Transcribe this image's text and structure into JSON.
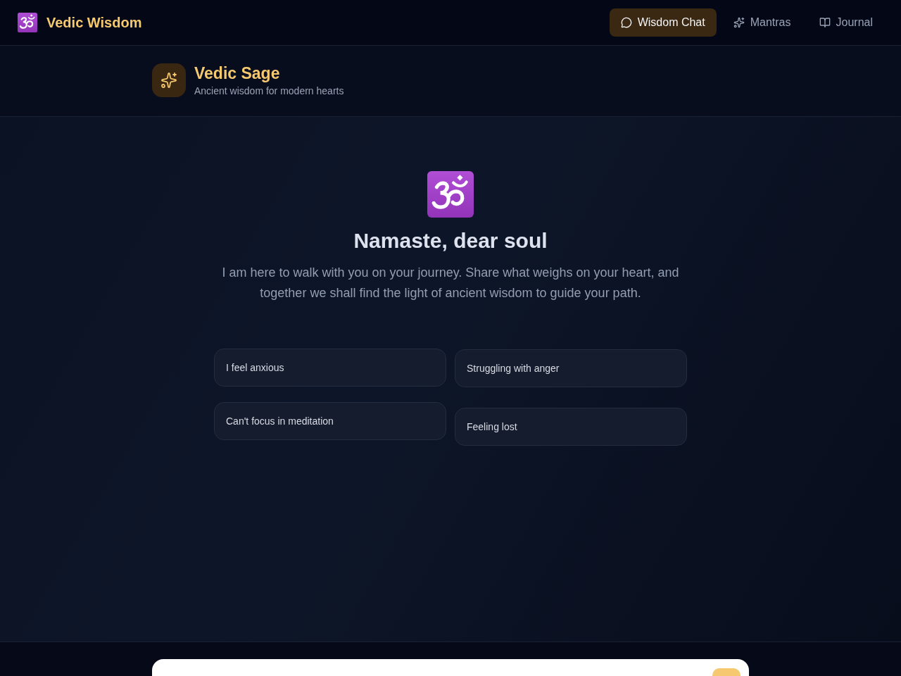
{
  "nav": {
    "brand": "Vedic Wisdom",
    "tabs": [
      {
        "label": "Wisdom Chat",
        "selected": true
      },
      {
        "label": "Mantras",
        "selected": false
      },
      {
        "label": "Journal",
        "selected": false
      }
    ]
  },
  "header": {
    "title": "Vedic Sage",
    "subtitle": "Ancient wisdom for modern hearts"
  },
  "welcome": {
    "heading": "Namaste, dear soul",
    "message": "I am here to walk with you on your journey. Share what weighs on your heart, and together we shall find the light of ancient wisdom to guide your path."
  },
  "suggestions": [
    "I feel anxious",
    "Struggling with anger",
    "Can't focus in meditation",
    "Feeling lost"
  ]
}
